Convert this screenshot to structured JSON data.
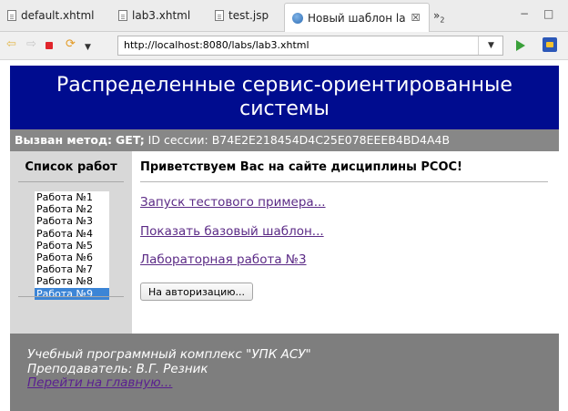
{
  "tabs": [
    {
      "label": "default.xhtml"
    },
    {
      "label": "lab3.xhtml"
    },
    {
      "label": "test.jsp"
    },
    {
      "label": "Новый шаблон la",
      "close": "☒"
    }
  ],
  "tab_overflow": {
    "symbol": "»",
    "count": "2"
  },
  "window_controls": {
    "minimize": "−",
    "maximize": "□"
  },
  "toolbar": {
    "url": "http://localhost:8080/labs/lab3.xhtml"
  },
  "page": {
    "header_title": "Распределенные сервис-ориентированные системы",
    "info": {
      "method_label": "Вызван метод:",
      "method_value": "GET;",
      "session_label": "ID сессии:",
      "session_id": "B74E2E218454D4C25E078EEEB4BD4A4B"
    },
    "sidebar": {
      "title": "Список работ",
      "works": [
        "Работа №1",
        "Работа №2",
        "Работа №3",
        "Работа №4",
        "Работа №5",
        "Работа №6",
        "Работа №7",
        "Работа №8",
        "Работа №9"
      ],
      "selected_index": 8
    },
    "content": {
      "welcome": "Приветствуем Вас на сайте дисциплины РСОС!",
      "links": [
        "Запуск тестового примера...",
        "Показать базовый шаблон...",
        "Лабораторная работа №3"
      ],
      "auth_button": "На авторизацию..."
    },
    "footer": {
      "line1": "Учебный программный комплекс \"УПК АСУ\"",
      "line2": "Преподаватель: В.Г. Резник",
      "home_link": "Перейти на главную..."
    }
  },
  "colors": {
    "header_bg": "#000c8f",
    "infobar_bg": "#878787",
    "footer_bg": "#7e7e7e",
    "link": "#5b2a86",
    "selected": "#3c85d6"
  },
  "icons": [
    "file-icon",
    "globe-icon",
    "back-arrow-icon",
    "forward-arrow-icon",
    "stop-icon",
    "refresh-icon",
    "dropdown-icon",
    "go-icon",
    "extension-icon"
  ]
}
